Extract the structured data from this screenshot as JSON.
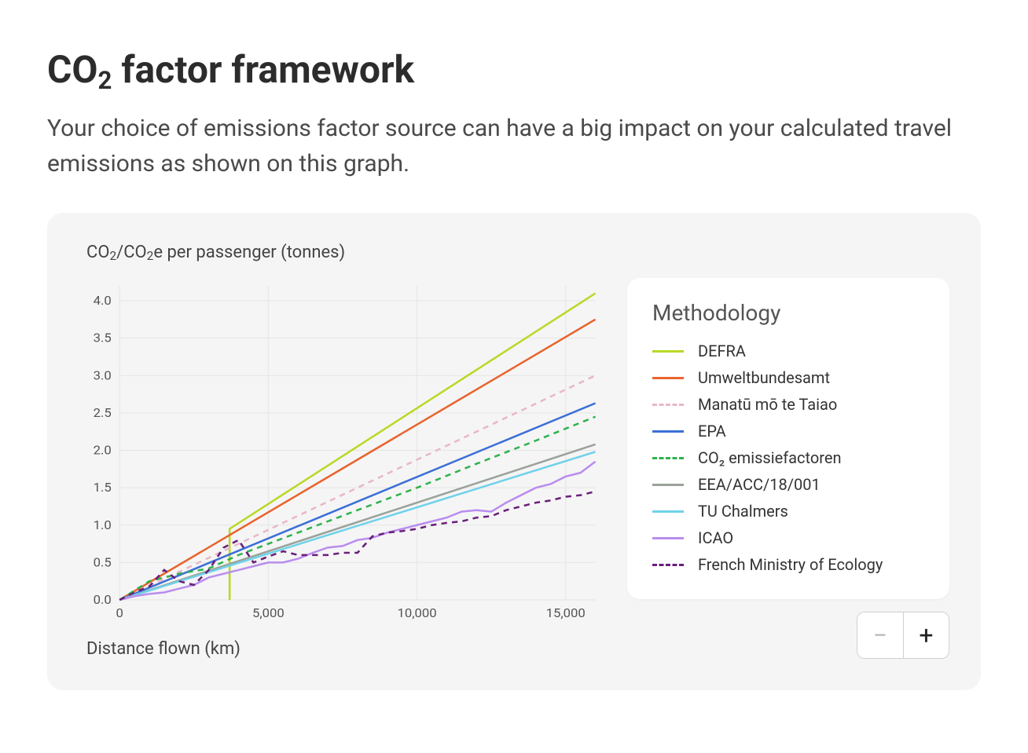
{
  "title_html": "CO<sub>2</sub> factor framework",
  "subtitle": "Your choice of emissions factor source can have a big impact on your calculated travel emissions as shown on this graph.",
  "y_axis_title_html": "CO<sub>2</sub>/CO<sub>2</sub>e per passenger (tonnes)",
  "x_axis_title": "Distance flown (km)",
  "legend_title": "Methodology",
  "zoom_out_label": "−",
  "zoom_in_label": "+",
  "chart_data": {
    "type": "line",
    "xlabel": "Distance flown (km)",
    "ylabel": "CO2/CO2e per passenger (tonnes)",
    "xlim": [
      0,
      16000
    ],
    "ylim": [
      0,
      4.2
    ],
    "x_ticks": [
      0,
      5000,
      10000,
      15000
    ],
    "x_tick_labels": [
      "0",
      "5,000",
      "10,000",
      "15,000"
    ],
    "y_ticks": [
      0.0,
      0.5,
      1.0,
      1.5,
      2.0,
      2.5,
      3.0,
      3.5,
      4.0
    ],
    "series": [
      {
        "name": "DEFRA",
        "color": "#b8d926",
        "dashed": false,
        "points": [
          [
            3700,
            0.0
          ],
          [
            3700,
            0.95
          ],
          [
            16000,
            4.1
          ]
        ]
      },
      {
        "name": "Umweltbundesamt",
        "color": "#e8642d",
        "dashed": false,
        "points": [
          [
            0,
            0
          ],
          [
            16000,
            3.75
          ]
        ]
      },
      {
        "name": "Manatū mō te Taiao",
        "color": "#e9b7c6",
        "dashed": true,
        "points": [
          [
            0,
            0
          ],
          [
            16000,
            3.0
          ]
        ]
      },
      {
        "name": "EPA",
        "color": "#3b6fd6",
        "dashed": false,
        "points": [
          [
            0,
            0
          ],
          [
            16000,
            2.63
          ]
        ]
      },
      {
        "name": "CO₂ emissiefactoren",
        "color": "#2eb24d",
        "dashed": true,
        "points": [
          [
            0,
            0
          ],
          [
            1000,
            0.25
          ],
          [
            2000,
            0.35
          ],
          [
            3000,
            0.42
          ],
          [
            4000,
            0.6
          ],
          [
            6000,
            0.9
          ],
          [
            8000,
            1.2
          ],
          [
            10000,
            1.5
          ],
          [
            12000,
            1.82
          ],
          [
            14000,
            2.13
          ],
          [
            16000,
            2.45
          ]
        ]
      },
      {
        "name": "EEA/ACC/18/001",
        "color": "#9aa29a",
        "dashed": false,
        "points": [
          [
            0,
            0
          ],
          [
            16000,
            2.08
          ]
        ]
      },
      {
        "name": "TU Chalmers",
        "color": "#6fd2ea",
        "dashed": false,
        "points": [
          [
            0,
            0
          ],
          [
            16000,
            1.98
          ]
        ]
      },
      {
        "name": "ICAO",
        "color": "#b98dee",
        "dashed": false,
        "points": [
          [
            0,
            0
          ],
          [
            500,
            0.05
          ],
          [
            1000,
            0.08
          ],
          [
            1500,
            0.1
          ],
          [
            2000,
            0.15
          ],
          [
            2500,
            0.2
          ],
          [
            3000,
            0.3
          ],
          [
            3500,
            0.35
          ],
          [
            4000,
            0.4
          ],
          [
            4500,
            0.45
          ],
          [
            5000,
            0.5
          ],
          [
            5500,
            0.5
          ],
          [
            6000,
            0.55
          ],
          [
            6500,
            0.63
          ],
          [
            7000,
            0.7
          ],
          [
            7500,
            0.72
          ],
          [
            8000,
            0.8
          ],
          [
            8500,
            0.83
          ],
          [
            9000,
            0.9
          ],
          [
            9500,
            0.95
          ],
          [
            10000,
            1.0
          ],
          [
            10500,
            1.05
          ],
          [
            11000,
            1.1
          ],
          [
            11500,
            1.18
          ],
          [
            12000,
            1.2
          ],
          [
            12500,
            1.18
          ],
          [
            13000,
            1.3
          ],
          [
            13500,
            1.4
          ],
          [
            14000,
            1.5
          ],
          [
            14500,
            1.55
          ],
          [
            15000,
            1.65
          ],
          [
            15500,
            1.7
          ],
          [
            16000,
            1.85
          ]
        ]
      },
      {
        "name": "French Ministry of Ecology",
        "color": "#6a1e7a",
        "dashed": true,
        "points": [
          [
            0,
            0
          ],
          [
            500,
            0.1
          ],
          [
            1000,
            0.18
          ],
          [
            1500,
            0.4
          ],
          [
            2000,
            0.25
          ],
          [
            2500,
            0.2
          ],
          [
            3000,
            0.4
          ],
          [
            3500,
            0.7
          ],
          [
            4000,
            0.8
          ],
          [
            4500,
            0.5
          ],
          [
            5000,
            0.58
          ],
          [
            5500,
            0.65
          ],
          [
            6000,
            0.6
          ],
          [
            6500,
            0.6
          ],
          [
            7000,
            0.6
          ],
          [
            7500,
            0.63
          ],
          [
            8000,
            0.63
          ],
          [
            8500,
            0.85
          ],
          [
            9000,
            0.9
          ],
          [
            9500,
            0.92
          ],
          [
            10000,
            0.95
          ],
          [
            10500,
            1.0
          ],
          [
            11000,
            1.03
          ],
          [
            11500,
            1.05
          ],
          [
            12000,
            1.1
          ],
          [
            12500,
            1.12
          ],
          [
            13000,
            1.2
          ],
          [
            13500,
            1.25
          ],
          [
            14000,
            1.3
          ],
          [
            14500,
            1.33
          ],
          [
            15000,
            1.38
          ],
          [
            15500,
            1.4
          ],
          [
            16000,
            1.45
          ]
        ]
      }
    ]
  }
}
